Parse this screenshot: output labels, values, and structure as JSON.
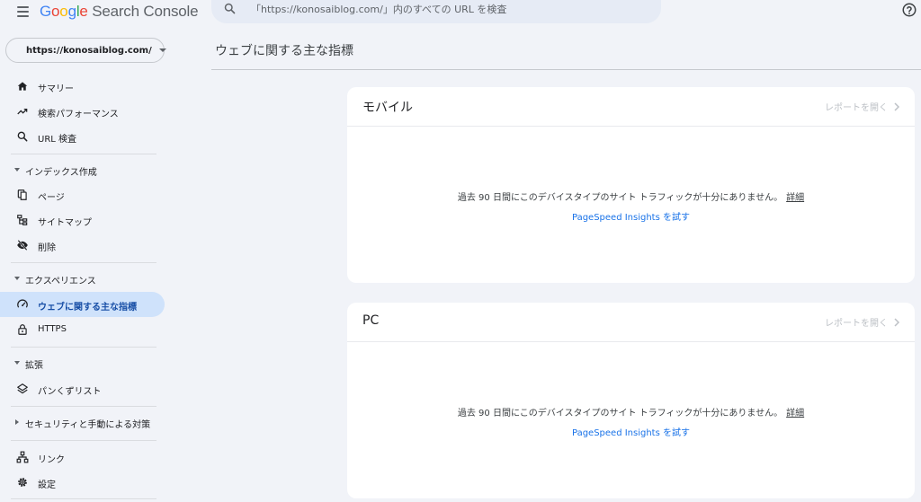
{
  "app": {
    "brand_letters": [
      "G",
      "o",
      "o",
      "g",
      "l",
      "e"
    ],
    "brand_product": " Search Console",
    "search_placeholder": "「https://konosaiblog.com/」内のすべての URL を検査"
  },
  "property": {
    "url": "https://konosaiblog.com/"
  },
  "sidebar": {
    "top_items": [
      {
        "label": "サマリー",
        "icon": "home-icon"
      },
      {
        "label": "検索パフォーマンス",
        "icon": "trending-up-icon"
      },
      {
        "label": "URL 検査",
        "icon": "search-icon"
      }
    ],
    "sections": [
      {
        "label": "インデックス作成",
        "expanded": true,
        "items": [
          {
            "label": "ページ",
            "icon": "pages-icon"
          },
          {
            "label": "サイトマップ",
            "icon": "sitemap-icon"
          },
          {
            "label": "削除",
            "icon": "visibility-off-icon"
          }
        ]
      },
      {
        "label": "エクスペリエンス",
        "expanded": true,
        "items": [
          {
            "label": "ウェブに関する主な指標",
            "icon": "speed-gauge-icon",
            "active": true
          },
          {
            "label": "HTTPS",
            "icon": "lock-icon"
          }
        ]
      },
      {
        "label": "拡張",
        "expanded": true,
        "items": [
          {
            "label": "パンくずリスト",
            "icon": "layers-icon"
          }
        ]
      },
      {
        "label": "セキュリティと手動による対策",
        "expanded": false,
        "items": []
      }
    ],
    "bottom_items": [
      {
        "label": "リンク",
        "icon": "links-icon"
      },
      {
        "label": "設定",
        "icon": "gear-icon"
      }
    ]
  },
  "main": {
    "title": "ウェブに関する主な指標",
    "cards": [
      {
        "title": "モバイル",
        "open_report": "レポートを開く",
        "message": "過去 90 日間にこのデバイスタイプのサイト トラフィックが十分にありません。",
        "detail_link": "詳細",
        "psi_link": "PageSpeed Insights を試す"
      },
      {
        "title": "PC",
        "open_report": "レポートを開く",
        "message": "過去 90 日間にこのデバイスタイプのサイト トラフィックが十分にありません。",
        "detail_link": "詳細",
        "psi_link": "PageSpeed Insights を試す"
      }
    ]
  },
  "colors": {
    "accent": "#1a73e8",
    "active_bg": "#cfe2fb",
    "page_bg": "#f1f3f8"
  }
}
